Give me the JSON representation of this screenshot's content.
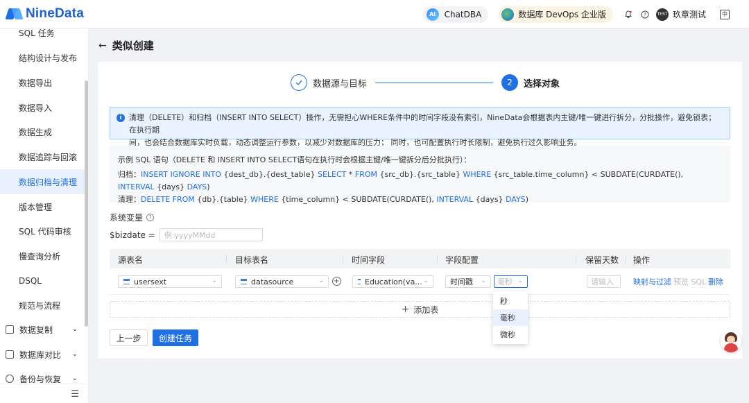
{
  "header": {
    "logo_text": "NineData",
    "chatdba_badge": "AI",
    "chatdba_label": "ChatDBA",
    "edition_label": "数据库 DevOps 企业版",
    "avatar_text": "TEST",
    "username": "玖章测试",
    "lang_glyph": "中"
  },
  "sidebar": {
    "items": [
      "SQL 任务",
      "结构设计与发布",
      "数据导出",
      "数据导入",
      "数据生成",
      "数据追踪与回滚",
      "数据归档与清理",
      "版本管理",
      "SQL 代码审核",
      "慢查询分析",
      "DSQL",
      "规范与流程"
    ],
    "active_item": "数据归档与清理",
    "groups": [
      "数据复制",
      "数据库对比",
      "备份与恢复"
    ]
  },
  "page": {
    "title": "类似创建",
    "steps": [
      {
        "index": "1",
        "label": "数据源与目标",
        "status": "done"
      },
      {
        "index": "2",
        "label": "选择对象",
        "status": "current"
      }
    ]
  },
  "info": {
    "line1": "清理（DELETE）和归档（INSERT INTO SELECT）操作，无需担心WHERE条件中的时间字段没有索引，NineData会根据表内主键/唯一键进行拆分，分批操作，避免锁表；  在执行期",
    "line2": "间，也会结合数据库实时负载，动态调整运行参数，以减少对数据库的压力；  同时，也可配置执行时长限制，避免执行过久影响业务。"
  },
  "example": {
    "title": "示例 SQL 语句（DELETE 和 INSERT INTO SELECT语句在执行时会根据主键/唯一键拆分后分批执行）：",
    "archive": {
      "label": "归档：",
      "t1": "INSERT IGNORE INTO",
      "t2": " {dest_db}.{dest_table} ",
      "t3": "SELECT",
      "t4": " * ",
      "t5": "FROM",
      "t6": " {src_db}.{src_table} ",
      "t7": "WHERE",
      "t8": " {src_table.time_column} < SUBDATE(CURDATE(), ",
      "t9": "INTERVAL",
      "t10": " {days} ",
      "t11": "DAYS",
      "t12": ")"
    },
    "cleanup": {
      "label": "清理：",
      "t1": "DELETE FROM",
      "t2": " {db}.{table} ",
      "t3": "WHERE",
      "t4": " {time_column} < SUBDATE(CURDATE(), ",
      "t5": "INTERVAL",
      "t6": " {days} ",
      "t7": "DAYS",
      "t8": ")"
    }
  },
  "sysvar": {
    "label": "系统变量",
    "help_glyph": "?",
    "bizdate_label": "$bizdate =",
    "bizdate_placeholder": "例:yyyyMMdd"
  },
  "table": {
    "headers": [
      "源表名",
      "目标表名",
      "时间字段",
      "字段配置",
      "保留天数",
      "操作"
    ],
    "row": {
      "source_table": "usersext",
      "target_table": "datasource",
      "time_field": "Education(va...",
      "field_type": "时间戳",
      "field_unit": "毫秒",
      "retain_days_placeholder": "请输入",
      "action_map": "映射与过滤",
      "action_preview": "预览 SQL",
      "action_delete": "删除"
    },
    "unit_options": [
      "秒",
      "毫秒",
      "微秒"
    ],
    "unit_selected": "毫秒"
  },
  "add_table_label": "添加表",
  "buttons": {
    "prev": "上一步",
    "create": "创建任务"
  }
}
